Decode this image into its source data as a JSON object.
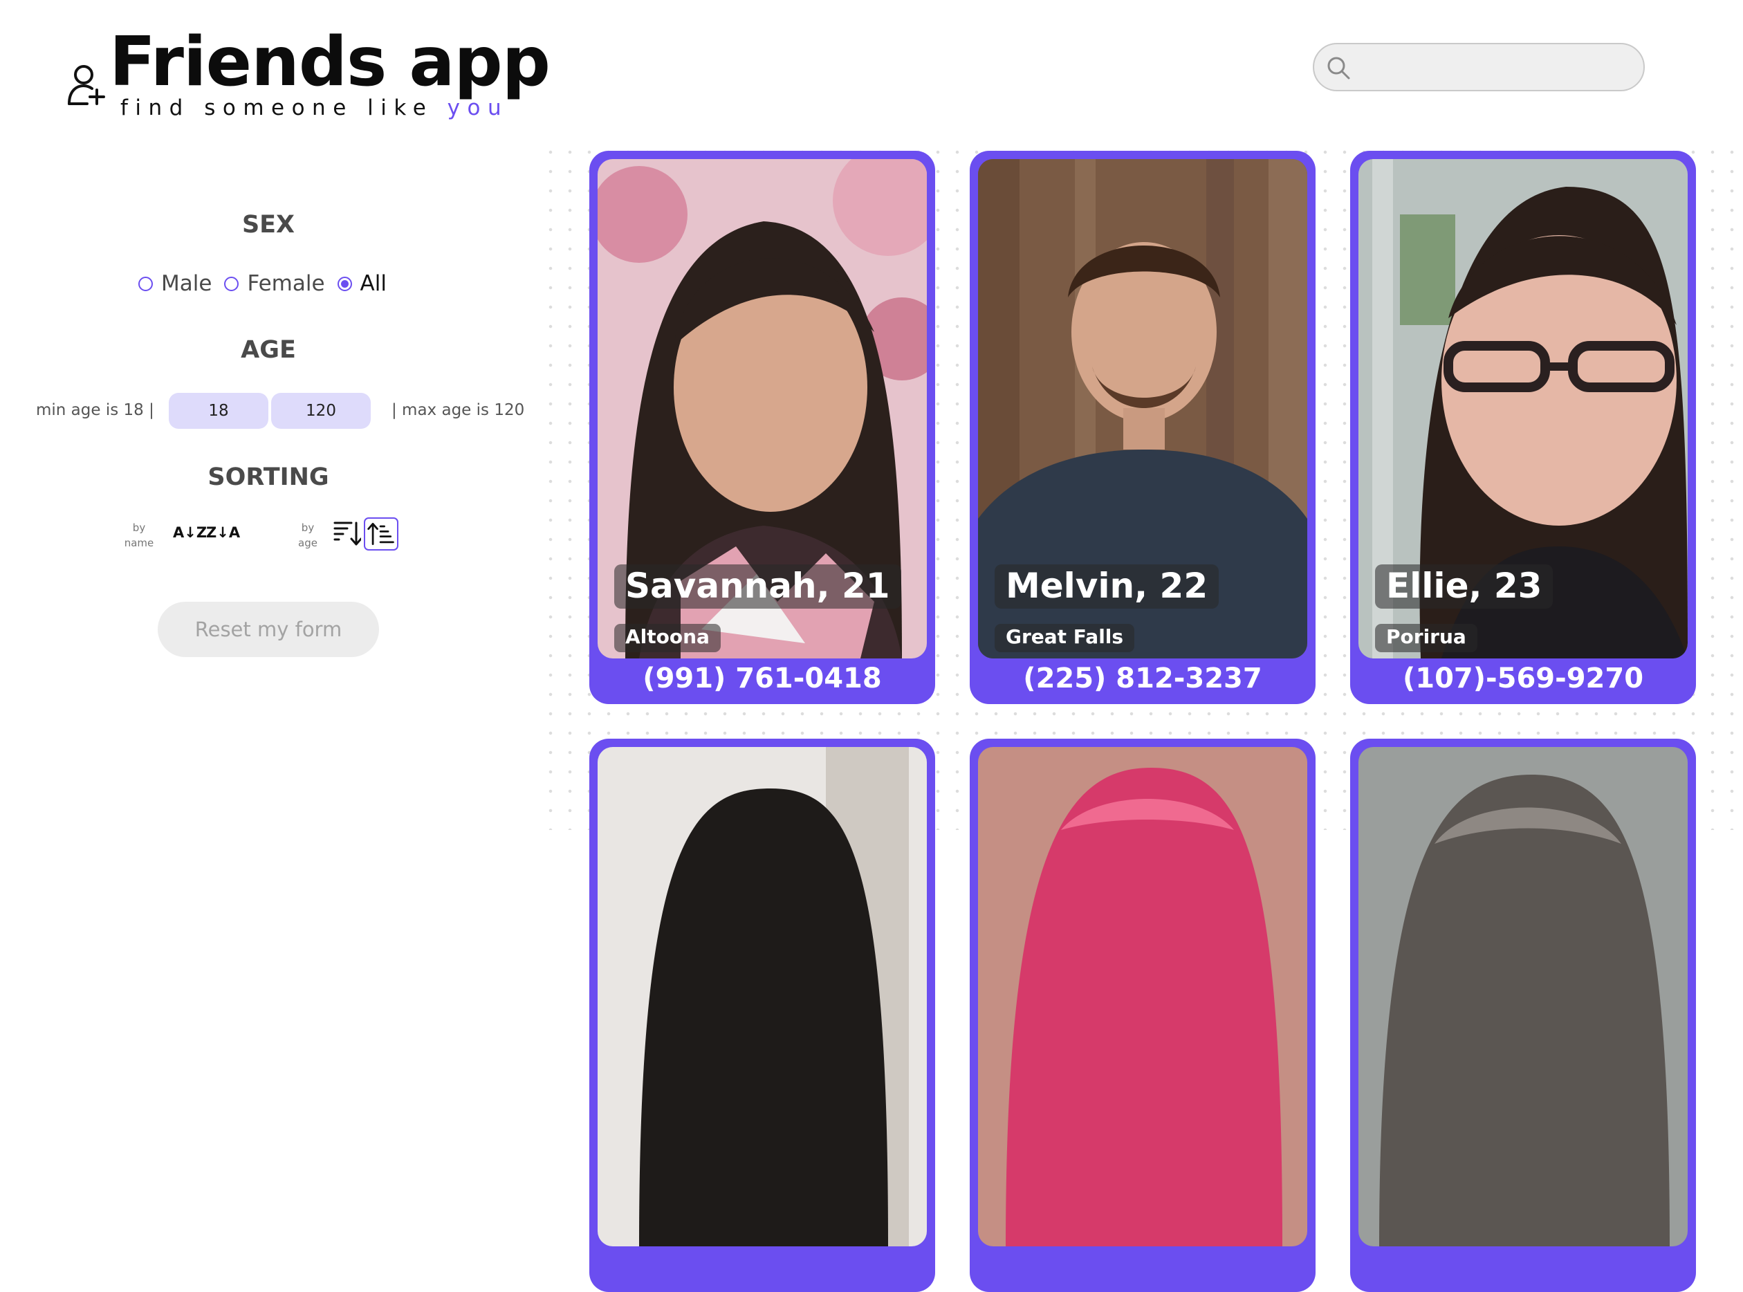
{
  "header": {
    "title": "Friends app",
    "tagline_main": "find someone like ",
    "tagline_accent": "you",
    "search_value": "",
    "search_placeholder": ""
  },
  "filters": {
    "sex_title": "SEX",
    "sex_options": [
      {
        "label": "Male",
        "checked": false
      },
      {
        "label": "Female",
        "checked": false
      },
      {
        "label": "All",
        "checked": true
      }
    ],
    "age_title": "AGE",
    "min_note": "min age is 18 |",
    "max_note": "| max age is 120",
    "min_age": "18",
    "max_age": "120",
    "sorting_title": "SORTING",
    "by_name_caption_1": "by",
    "by_name_caption_2": "name",
    "by_age_caption_1": "by",
    "by_age_caption_2": "age",
    "sort_az": "A↓Z",
    "sort_za": "Z↓A",
    "reset_label": "Reset my form"
  },
  "colors": {
    "accent": "#6b4ef0",
    "input_bg": "#dedbfb",
    "reset_bg": "#ececec"
  },
  "cards": [
    {
      "name": "Savannah, 21",
      "city": "Altoona",
      "phone": "(991) 761-0418"
    },
    {
      "name": "Melvin, 22",
      "city": "Great Falls",
      "phone": "(225) 812-3237"
    },
    {
      "name": "Ellie, 23",
      "city": "Porirua",
      "phone": "(107)-569-9270"
    },
    {
      "name": "",
      "city": "",
      "phone": ""
    },
    {
      "name": "",
      "city": "",
      "phone": ""
    },
    {
      "name": "",
      "city": "",
      "phone": ""
    }
  ]
}
